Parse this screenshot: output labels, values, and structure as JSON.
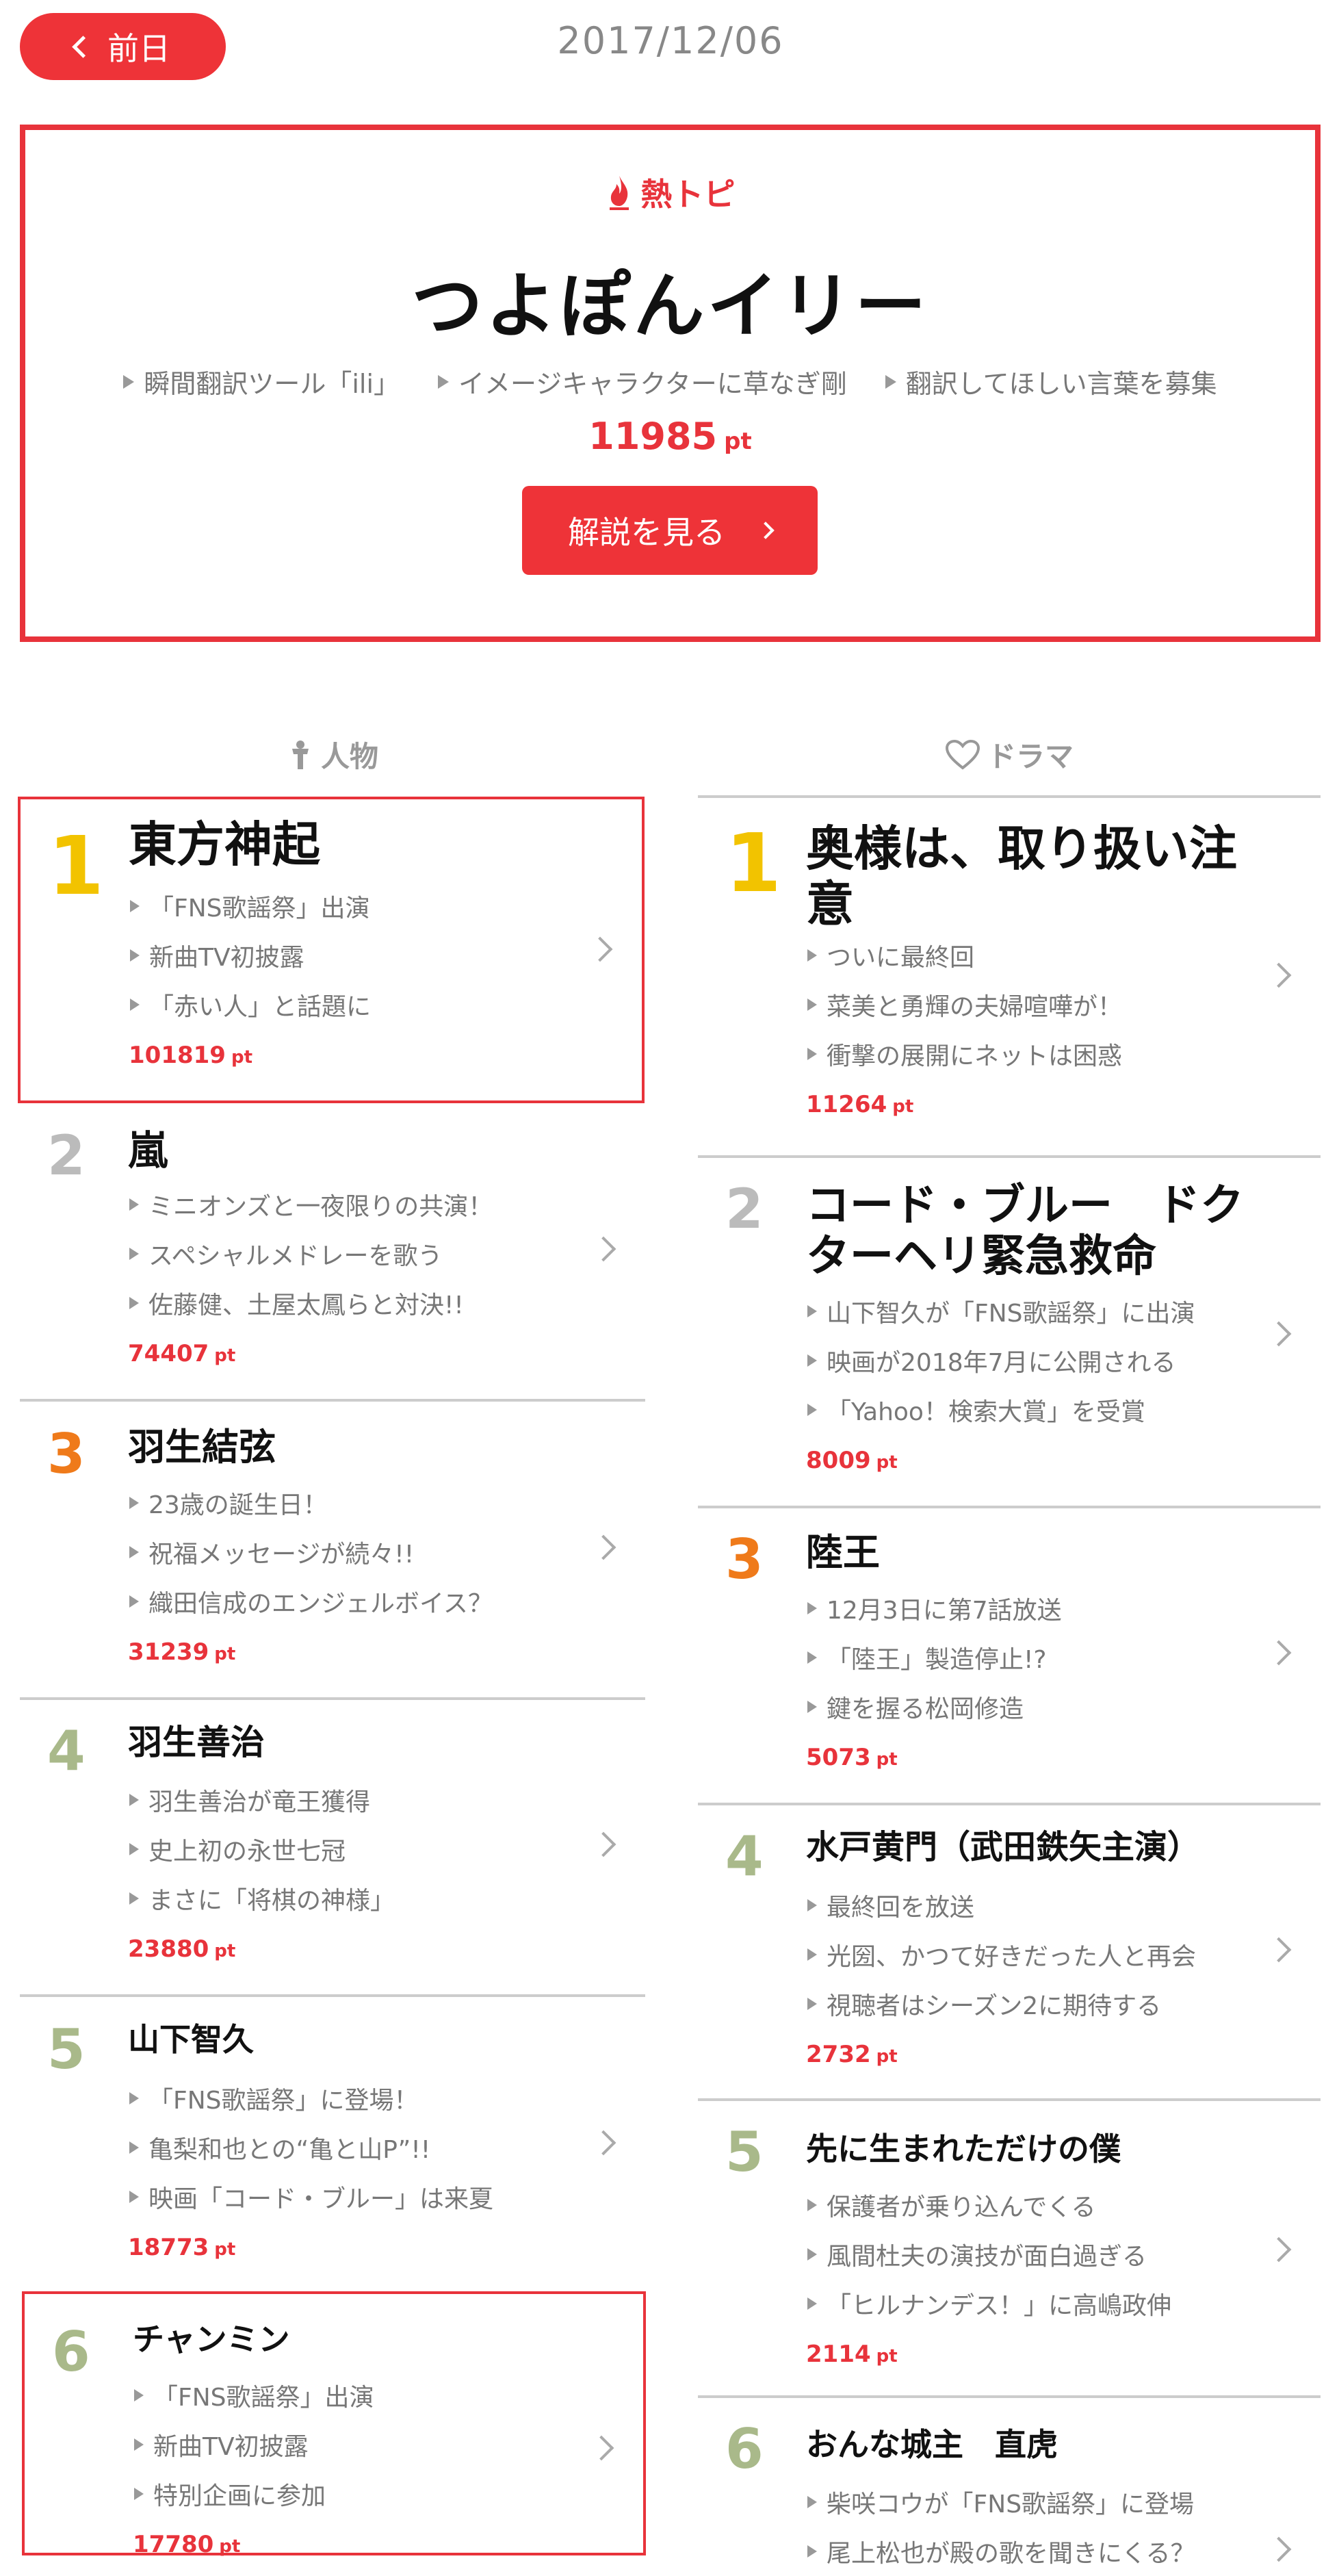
{
  "header": {
    "prev_label": "前日",
    "date": "2017/12/06"
  },
  "hot": {
    "label": "熱トピ",
    "title": "つよぽんイリー",
    "points": [
      "瞬間翻訳ツール「ili」",
      "イメージキャラクターに草なぎ剛",
      "翻訳してほしい言葉を募集"
    ],
    "score": "11985",
    "unit": "pt",
    "button_label": "解説を見る"
  },
  "people": {
    "heading": "人物",
    "items": [
      {
        "rank": "1",
        "name": "東方神起",
        "bullets": [
          "「FNS歌謡祭」出演",
          "新曲TV初披露",
          "「赤い人」と話題に"
        ],
        "score": "101819"
      },
      {
        "rank": "2",
        "name": "嵐",
        "bullets": [
          "ミニオンズと一夜限りの共演！",
          "スペシャルメドレーを歌う",
          "佐藤健、土屋太鳳らと対決!!"
        ],
        "score": "74407"
      },
      {
        "rank": "3",
        "name": "羽生結弦",
        "bullets": [
          "23歳の誕生日！",
          "祝福メッセージが続々!!",
          "織田信成のエンジェルボイス？"
        ],
        "score": "31239"
      },
      {
        "rank": "4",
        "name": "羽生善治",
        "bullets": [
          "羽生善治が竜王獲得",
          "史上初の永世七冠",
          "まさに「将棋の神様」"
        ],
        "score": "23880"
      },
      {
        "rank": "5",
        "name": "山下智久",
        "bullets": [
          "「FNS歌謡祭」に登場！",
          "亀梨和也との“亀と山P”!!",
          "映画「コード・ブルー」は来夏"
        ],
        "score": "18773"
      },
      {
        "rank": "6",
        "name": "チャンミン",
        "bullets": [
          "「FNS歌謡祭」出演",
          "新曲TV初披露",
          "特別企画に参加"
        ],
        "score": "17780"
      }
    ]
  },
  "drama": {
    "heading": "ドラマ",
    "items": [
      {
        "rank": "1",
        "name": "奥様は、取り扱い注意",
        "bullets": [
          "ついに最終回",
          "菜美と勇輝の夫婦喧嘩が！",
          "衝撃の展開にネットは困惑"
        ],
        "score": "11264"
      },
      {
        "rank": "2",
        "name": "コード・ブルー　ドクターヘリ緊急救命",
        "bullets": [
          "山下智久が「FNS歌謡祭」に出演",
          "映画が2018年7月に公開される",
          "「Yahoo！検索大賞」を受賞"
        ],
        "score": "8009"
      },
      {
        "rank": "3",
        "name": "陸王",
        "bullets": [
          "12月3日に第7話放送",
          "「陸王」製造停止!?",
          "鍵を握る松岡修造"
        ],
        "score": "5073"
      },
      {
        "rank": "4",
        "name": "水戸黄門（武田鉄矢主演）",
        "bullets": [
          "最終回を放送",
          "光圀、かつて好きだった人と再会",
          "視聴者はシーズン2に期待する"
        ],
        "score": "2732"
      },
      {
        "rank": "5",
        "name": "先に生まれただけの僕",
        "bullets": [
          "保護者が乗り込んでくる",
          "風間杜夫の演技が面白過ぎる",
          "「ヒルナンデス！」に高嶋政伸"
        ],
        "score": "2114"
      },
      {
        "rank": "6",
        "name": "おんな城主　直虎",
        "bullets": [
          "柴咲コウが「FNS歌謡祭」に登場",
          "尾上松也が殿の歌を聞きにくる？"
        ],
        "score": ""
      }
    ]
  },
  "colors": {
    "accent": "#e8333b",
    "gold": "#f2c300",
    "silver": "#bbbbbb",
    "bronze": "#ef7a1a",
    "other": "#a9b98a"
  }
}
